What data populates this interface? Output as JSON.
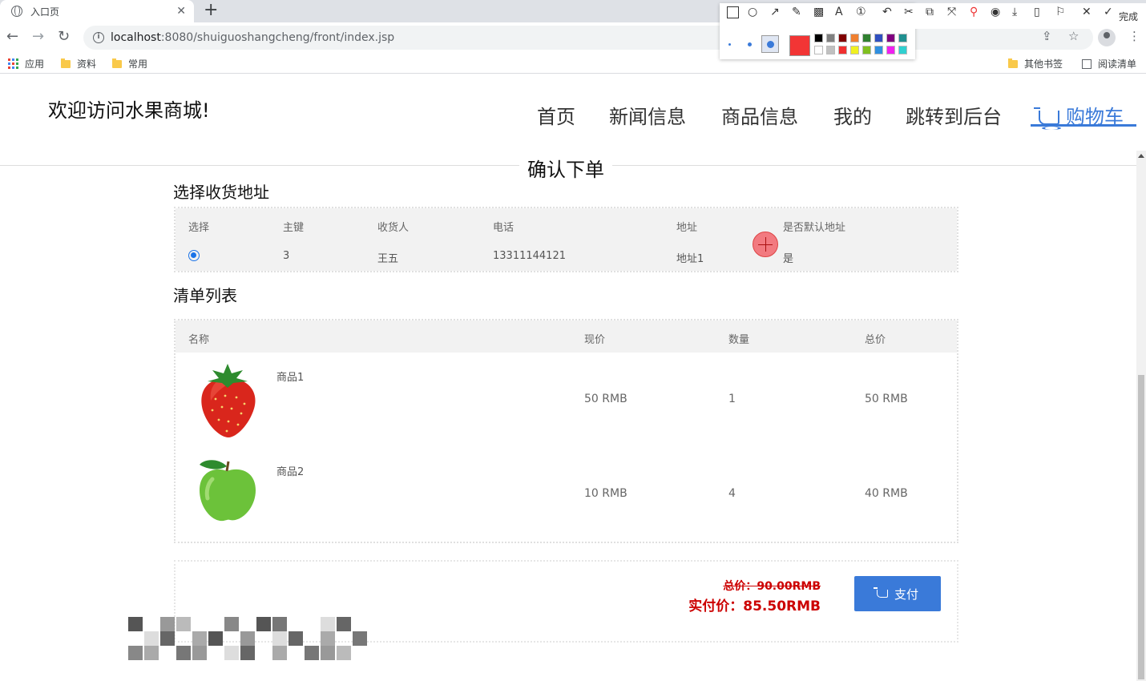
{
  "browser": {
    "tab_title": "入口页",
    "url_host": "localhost",
    "url_path": ":8080/shuiguoshangcheng/front/index.jsp",
    "bookmarks": [
      "应用",
      "资料",
      "常用"
    ],
    "bookmarks_right": [
      "其他书签",
      "阅读清单"
    ]
  },
  "annotation_toolbar": {
    "done_label": "完成",
    "current_color": "#f23535",
    "palette": [
      "#000000",
      "#808080",
      "#800000",
      "#f08030",
      "#308030",
      "#3050c0",
      "#800080",
      "#209090",
      "#ffffff",
      "#c0c0c0",
      "#f03030",
      "#f0f020",
      "#80c020",
      "#3090e0",
      "#f020f0",
      "#30d0d0"
    ]
  },
  "site": {
    "title": "欢迎访问水果商城!",
    "nav": [
      "首页",
      "新闻信息",
      "商品信息",
      "我的",
      "跳转到后台",
      "购物车"
    ],
    "active_nav": "购物车",
    "accent_color": "#3a7ad9"
  },
  "order": {
    "title": "确认下单",
    "address_section": "选择收货地址",
    "address_headers": [
      "选择",
      "主键",
      "收货人",
      "电话",
      "地址",
      "是否默认地址"
    ],
    "addresses": [
      {
        "selected": true,
        "id": "3",
        "name": "王五",
        "phone": "13311144121",
        "address": "地址1",
        "is_default": "是"
      }
    ],
    "list_section": "清单列表",
    "list_headers": [
      "名称",
      "现价",
      "数量",
      "总价"
    ],
    "items": [
      {
        "name": "商品1",
        "price": "50 RMB",
        "qty": "1",
        "total": "50 RMB",
        "image": "strawberry"
      },
      {
        "name": "商品2",
        "price": "10 RMB",
        "qty": "4",
        "total": "40 RMB",
        "image": "green-apple"
      }
    ],
    "total_label": "总价：90.00RMB",
    "pay_label": "实付价：85.50RMB",
    "pay_button": "支付",
    "price_color": "#cc0000"
  }
}
